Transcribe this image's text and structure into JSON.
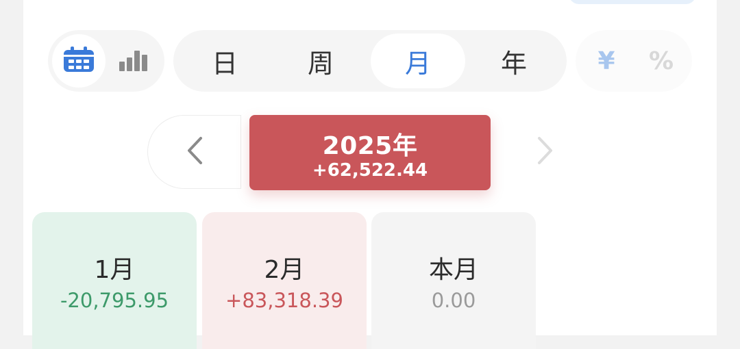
{
  "view_toggle": {
    "calendar_icon": "calendar-icon",
    "bar_chart_icon": "bar-chart-icon",
    "active": "calendar"
  },
  "period_tabs": [
    {
      "label": "日",
      "active": false
    },
    {
      "label": "周",
      "active": false
    },
    {
      "label": "月",
      "active": true
    },
    {
      "label": "年",
      "active": false
    }
  ],
  "units": {
    "currency": "¥",
    "percent": "%"
  },
  "year_summary": {
    "title": "2025年",
    "amount": "+62,522.44",
    "prev_icon": "chevron-left-icon",
    "next_icon": "chevron-right-icon"
  },
  "months": [
    {
      "label": "1月",
      "amount": "-20,795.95",
      "tone": "green"
    },
    {
      "label": "2月",
      "amount": "+83,318.39",
      "tone": "red"
    },
    {
      "label": "本月",
      "amount": "0.00",
      "tone": "gray"
    }
  ],
  "colors": {
    "accent": "#3a7ad9",
    "profit": "#c9565a",
    "loss": "#3d9a6a",
    "neutral": "#9a9a9a"
  }
}
